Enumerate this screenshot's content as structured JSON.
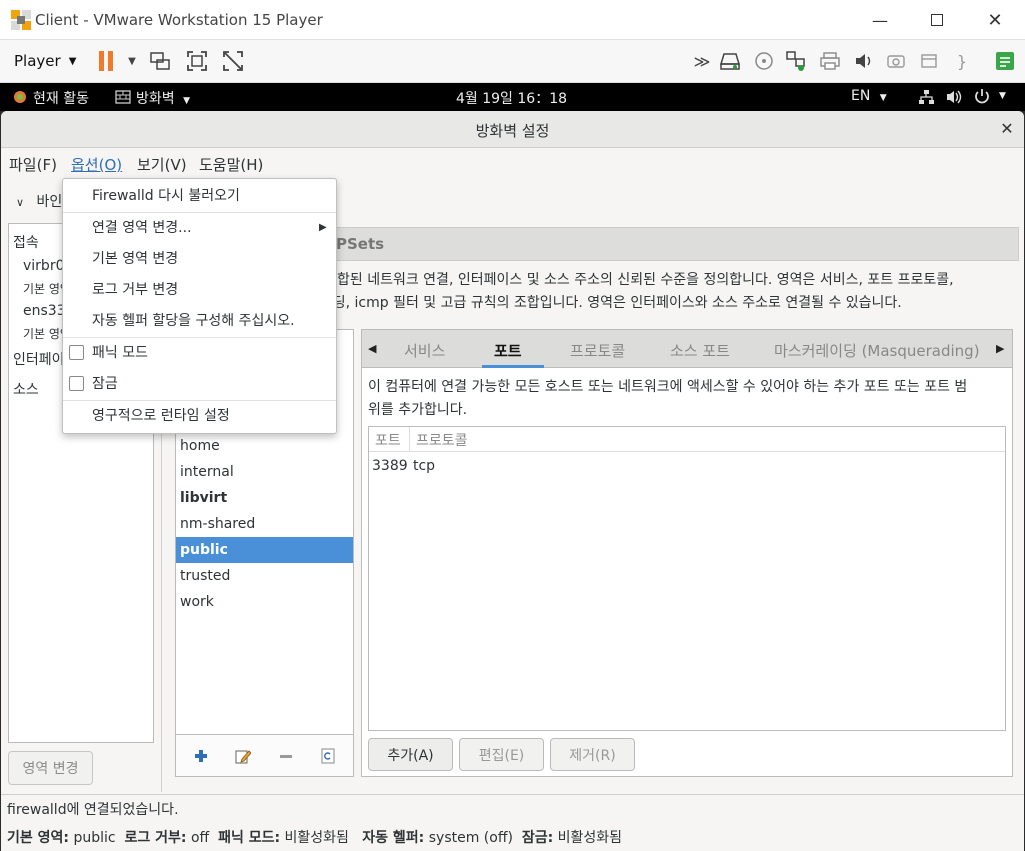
{
  "vm": {
    "title": "Client - VMware Workstation 15 Player",
    "player_menu": "Player"
  },
  "gnome": {
    "activities": "현재 활동",
    "app_menu": "방화벽",
    "clock": "4월 19일  16：18",
    "lang": "EN"
  },
  "dialog": {
    "title": "방화벽 설정",
    "menu": {
      "file": "파일(F)",
      "options": "옵션(O)",
      "view": "보기(V)",
      "help": "도움말(H)"
    },
    "options_menu": {
      "reload": "Firewalld 다시 불러오기",
      "change_conn_zone": "연결 영역 변경...",
      "change_default_zone": "기본 영역 변경",
      "change_log_denied": "로그 거부 변경",
      "auto_helpers": "자동 헬퍼 할당을 구성해 주십시오.",
      "panic_mode": "패닉 모드",
      "lockdown": "잠금",
      "runtime_to_permanent": "영구적으로 런타임 설정"
    },
    "binding_label": "바인",
    "connections": {
      "header": "접속",
      "virbr0": "virbr0",
      "virbr0_sub": "기본 영역",
      "ens33": "ens33",
      "ens33_sub": "기본 영역",
      "interfaces": "인터페이스",
      "sources": "소스"
    },
    "change_zone_button": "영역 변경",
    "ipsets_tab": "PSets",
    "description_line1": "합된 네트워크 연결, 인터페이스 및 소스 주소의 신뢰된 수준을 정의합니다. 영역은 서비스, 포트 프로토콜,",
    "description_line2": "포워딩, icmp 필터 및 고급 규칙의 조합입니다. 영역은 인터페이스와 소스 주소로 연결될 수 있습니다.",
    "zones": [
      "home",
      "internal",
      "libvirt",
      "nm-shared",
      "public",
      "trusted",
      "work"
    ],
    "selected_zone": "public",
    "tabs": {
      "services": "서비스",
      "ports": "포트",
      "protocols": "프로토콜",
      "source_ports": "소스 포트",
      "masquerading": "마스커레이딩 (Masquerading)"
    },
    "ports_desc_line1": "이 컴퓨터에 연결 가능한 모든 호스트 또는 네트워크에 액세스할 수 있어야 하는 추가 포트 또는 포트 범",
    "ports_desc_line2": "위를 추가합니다.",
    "ports_table": {
      "col_port": "포트",
      "col_protocol": "프로토콜",
      "rows": [
        {
          "port": "3389",
          "protocol": "tcp"
        }
      ]
    },
    "buttons": {
      "add": "추가(A)",
      "edit": "편집(E)",
      "remove": "제거(R)"
    },
    "status": {
      "message": "firewalld에 연결되었습니다.",
      "default_zone_label": "기본 영역:",
      "default_zone": "public",
      "log_denied_label": "로그 거부:",
      "log_denied": "off",
      "panic_label": "패닉 모드:",
      "panic": "비활성화됨",
      "helpers_label": "자동 헬퍼:",
      "helpers": "system (off)",
      "lockdown_label": "잠금:",
      "lockdown": "비활성화됨"
    }
  },
  "colors": {
    "accent": "#4a90d9",
    "pause": "#f07a2a"
  }
}
